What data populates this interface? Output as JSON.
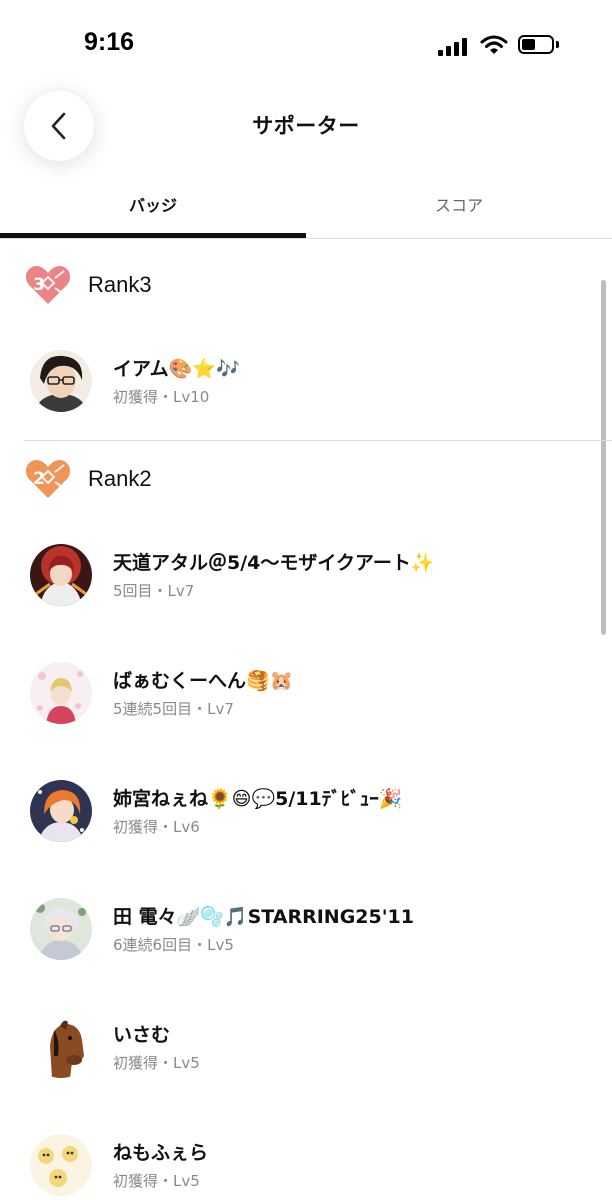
{
  "status": {
    "time": "9:16"
  },
  "header": {
    "title": "サポーター"
  },
  "tabs": [
    {
      "label": "バッジ",
      "active": true
    },
    {
      "label": "スコア",
      "active": false
    }
  ],
  "colors": {
    "rank3_badge": "#e98585",
    "rank2_badge": "#f0945a",
    "meta_text": "#8a8a8a",
    "accent": "#111111"
  },
  "ranks": [
    {
      "badge_number": "3",
      "label": "Rank3"
    },
    {
      "badge_number": "2",
      "label": "Rank2"
    }
  ],
  "supporters": [
    {
      "name": "イアム🎨⭐🎶",
      "meta": "初獲得・Lv10"
    },
    {
      "name": "天道アタル＠5/4～モザイクアート✨",
      "meta": "5回目・Lv7"
    },
    {
      "name": "ばぁむくーへん🥞🐹",
      "meta": "5連続5回目・Lv7"
    },
    {
      "name": "姉宮ねぇね🌻😄💬5/11ﾃﾞﾋﾞｭｰ🎉",
      "meta": "初獲得・Lv6"
    },
    {
      "name": "田 電々🪽🫧🎵STARRING25'11",
      "meta": "6連続6回目・Lv5"
    },
    {
      "name": "いさむ",
      "meta": "初獲得・Lv5"
    },
    {
      "name": "ねもふぇら",
      "meta": "初獲得・Lv5"
    }
  ]
}
